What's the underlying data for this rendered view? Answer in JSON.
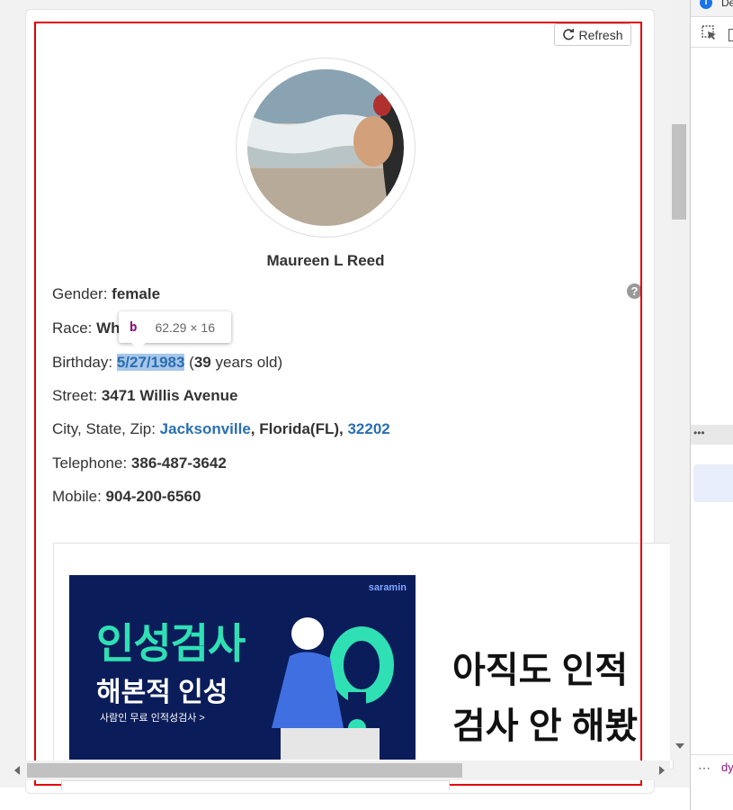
{
  "refresh_label": "Refresh",
  "profile": {
    "name": "Maureen L Reed",
    "gender_label": "Gender: ",
    "gender": "female",
    "race_label": "Race: ",
    "race_visible": "Wh",
    "birthday_label": "Birthday: ",
    "birthday": "5/27/1983",
    "age_open": " (",
    "age": "39",
    "age_close": " years old)",
    "street_label": "Street: ",
    "street": "3471 Willis Avenue",
    "city_label": "City, State, Zip: ",
    "city": "Jacksonville",
    "state": ", Florida(FL), ",
    "zip": "32202",
    "telephone_label": "Telephone: ",
    "telephone": "386-487-3642",
    "mobile_label": "Mobile: ",
    "mobile": "904-200-6560"
  },
  "help_glyph": "?",
  "inspector_tooltip": {
    "tag": "b",
    "size": "62.29 × 16"
  },
  "ad": {
    "brand": "saramin",
    "headline": "인성검사",
    "subheadline": "해본적 인성",
    "small": "사람인 무료 인적성검사 >",
    "text_line1": "아직도 인적",
    "text_line2": "검사 안 해봤"
  },
  "devtools": {
    "info_glyph": "i",
    "top_label": "De",
    "dots": "•••",
    "bottom_dots": "⋯",
    "bottom_text": "dy"
  },
  "colors": {
    "link": "#2a6fb0",
    "highlight": "#a7c6ea",
    "frame": "#e00000",
    "ad_bg": "#0b1c5a",
    "ad_accent": "#2fe0b4"
  }
}
